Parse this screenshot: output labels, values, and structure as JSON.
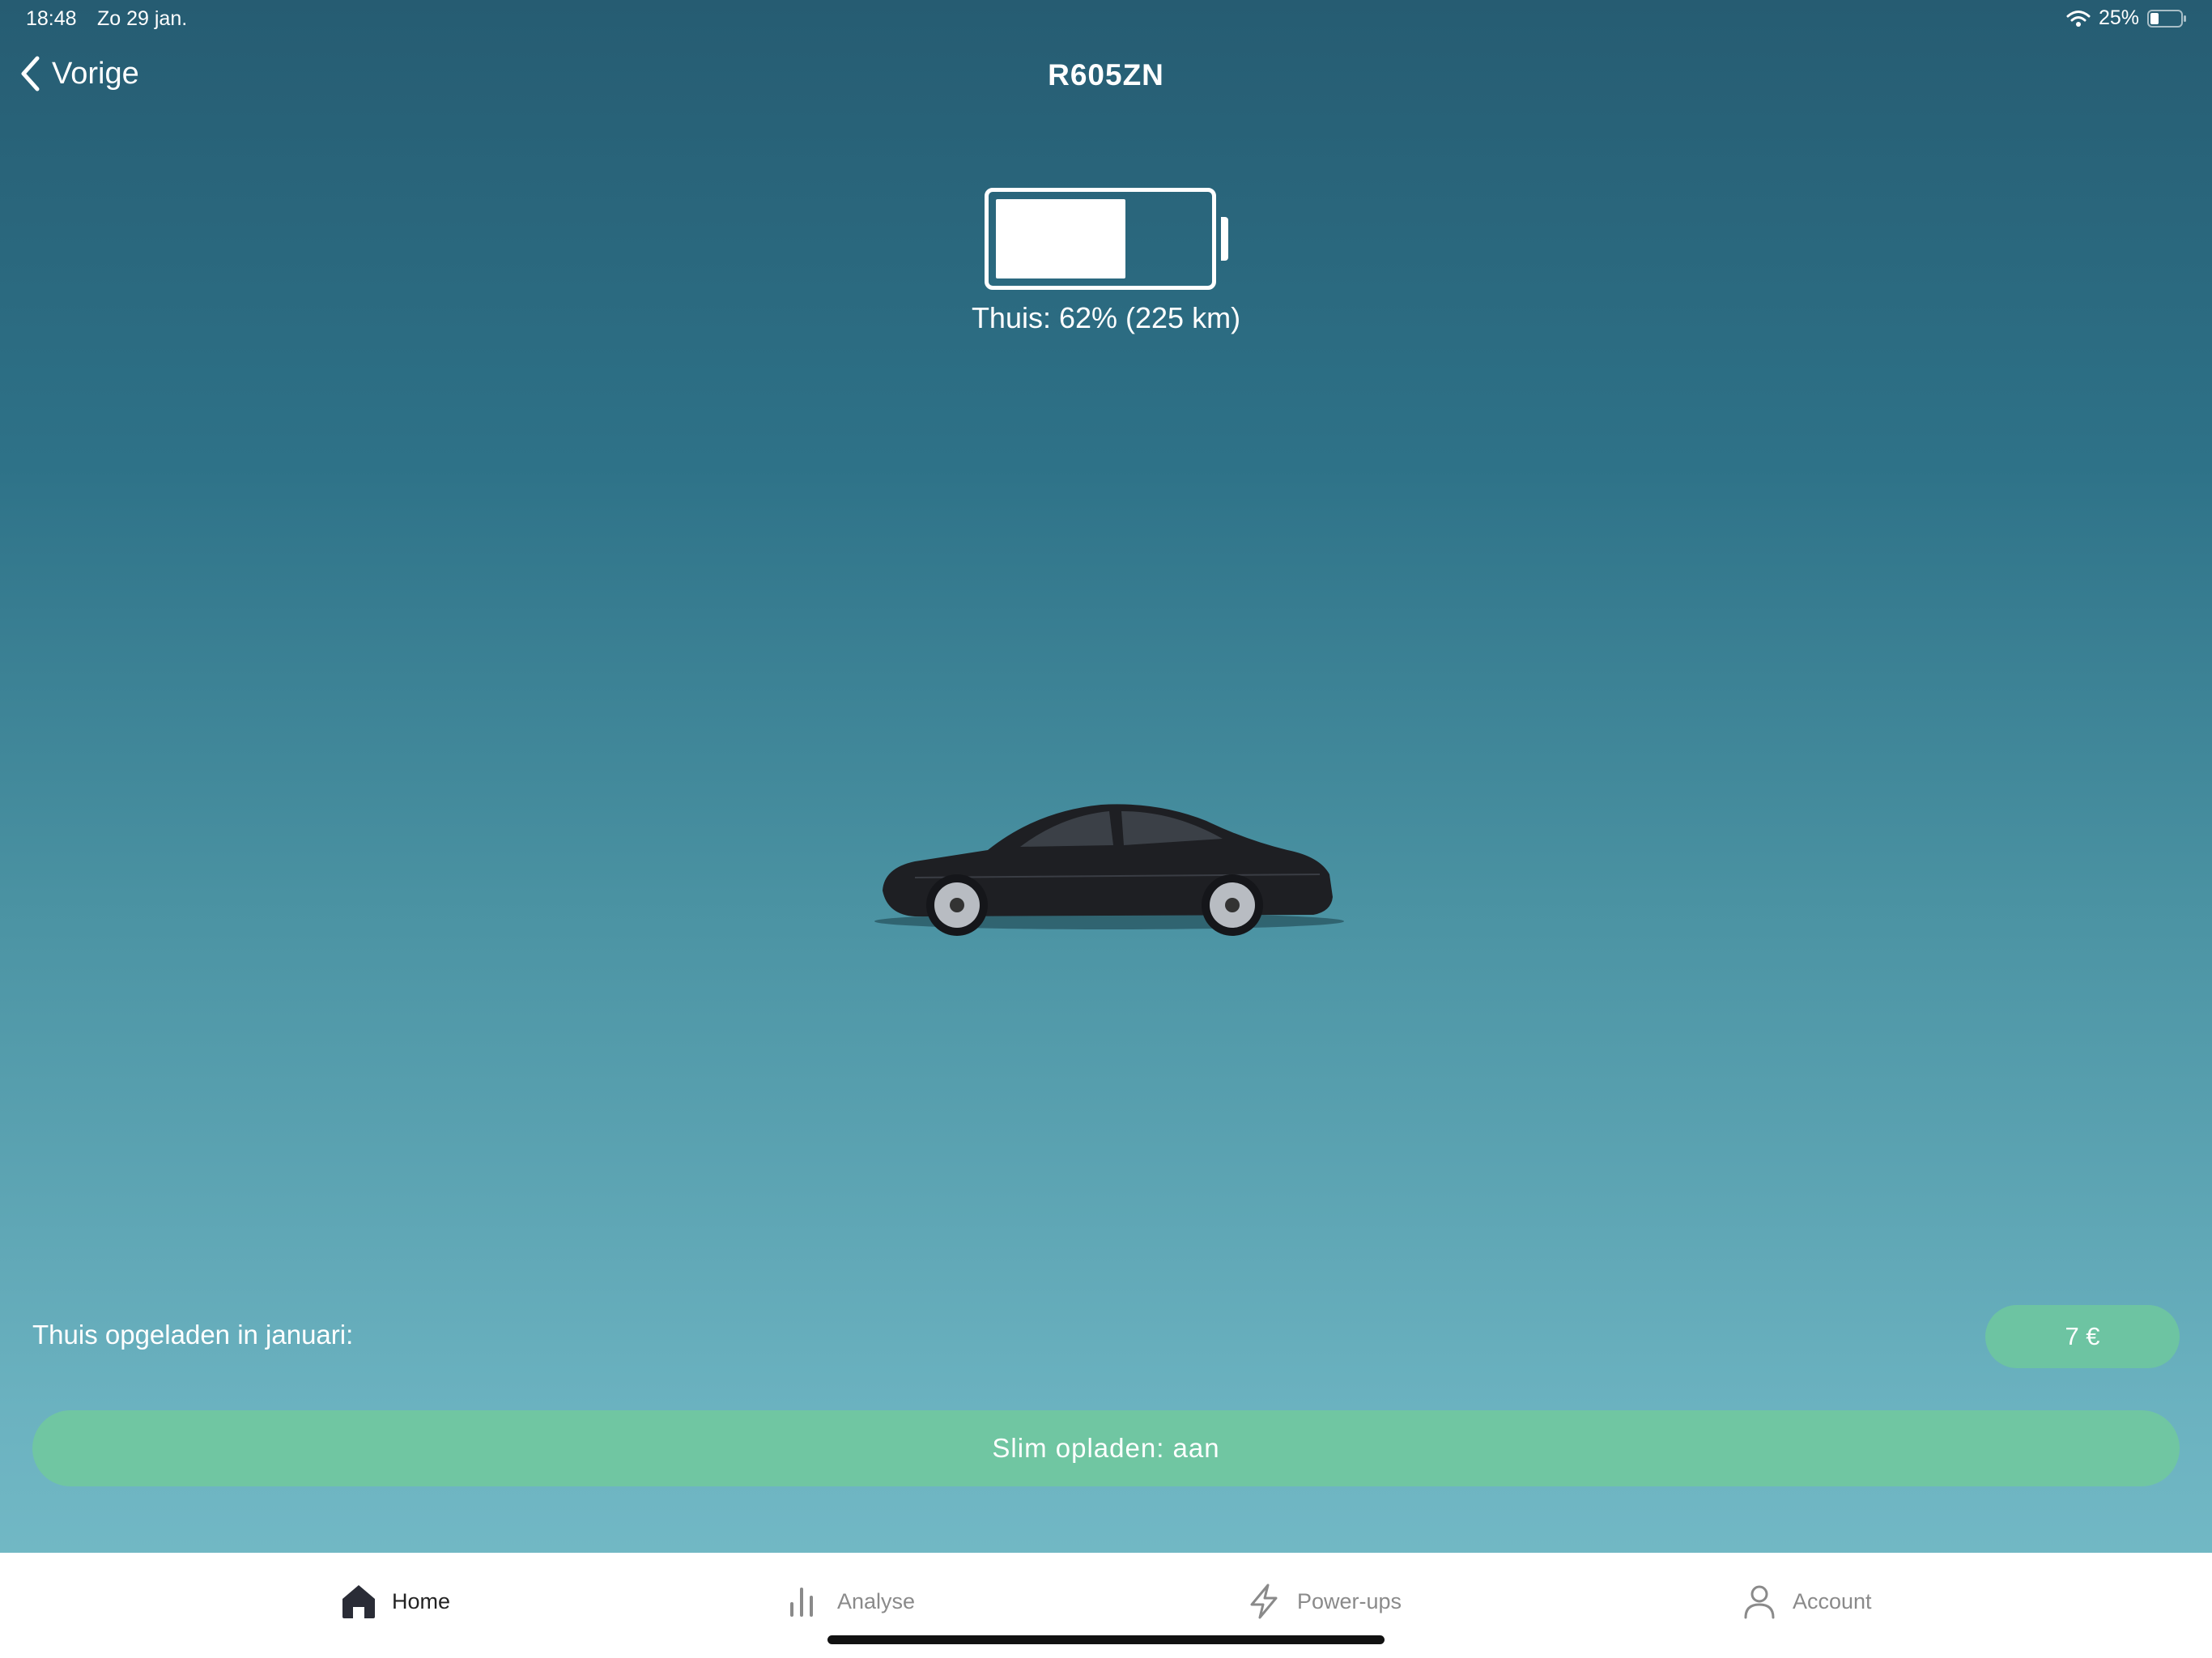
{
  "status_bar": {
    "time": "18:48",
    "date": "Zo 29 jan.",
    "battery_percent": "25%"
  },
  "nav": {
    "back_label": "Vorige",
    "title": "R605ZN"
  },
  "battery": {
    "level_fraction": 0.62,
    "label": "Thuis: 62% (225 km)"
  },
  "car": {
    "icon": "car-image",
    "color": "#1e1f23"
  },
  "summary": {
    "charged_label": "Thuis opgeladen in januari:",
    "charged_amount": "7 €"
  },
  "smart_charge": {
    "label": "Slim opladen: aan"
  },
  "tabs": [
    {
      "label": "Home",
      "icon": "home-icon",
      "active": true
    },
    {
      "label": "Analyse",
      "icon": "bar-chart-icon",
      "active": false
    },
    {
      "label": "Power-ups",
      "icon": "lightning-icon",
      "active": false
    },
    {
      "label": "Account",
      "icon": "person-icon",
      "active": false
    }
  ],
  "colors": {
    "accent_green": "#70c6a2",
    "background_top": "#265c72",
    "background_bottom": "#76bcc8"
  }
}
